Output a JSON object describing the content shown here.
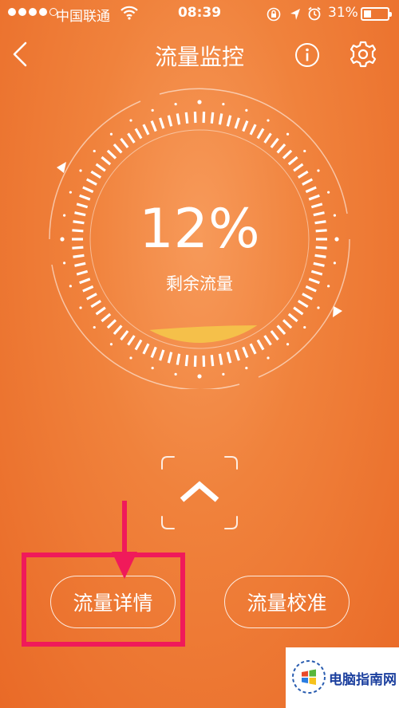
{
  "status_bar": {
    "signal_bars": 5,
    "signal_filled": 4,
    "carrier": "中国联通",
    "wifi_icon": "wifi-icon",
    "time": "08:39",
    "indicators": [
      "rotation-lock-icon",
      "location-arrow-icon",
      "alarm-icon"
    ],
    "battery_percent_label": "31%",
    "battery_level": 0.31
  },
  "nav": {
    "back_icon": "chevron-left-icon",
    "title": "流量监控",
    "info_icon": "info-icon",
    "settings_icon": "gear-icon"
  },
  "gauge": {
    "percent_label": "12%",
    "percent_value": 12,
    "caption": "剩余流量",
    "fill_color": "#f5c04a"
  },
  "expand": {
    "icon": "chevron-up-icon"
  },
  "buttons": {
    "detail": "流量详情",
    "calibrate": "流量校准"
  },
  "annotation": {
    "highlight_color": "#f01a5a",
    "arrow_icon": "arrow-down-icon"
  },
  "watermark": {
    "logo_icon": "windows-logo-icon",
    "text": "电脑指南网"
  }
}
